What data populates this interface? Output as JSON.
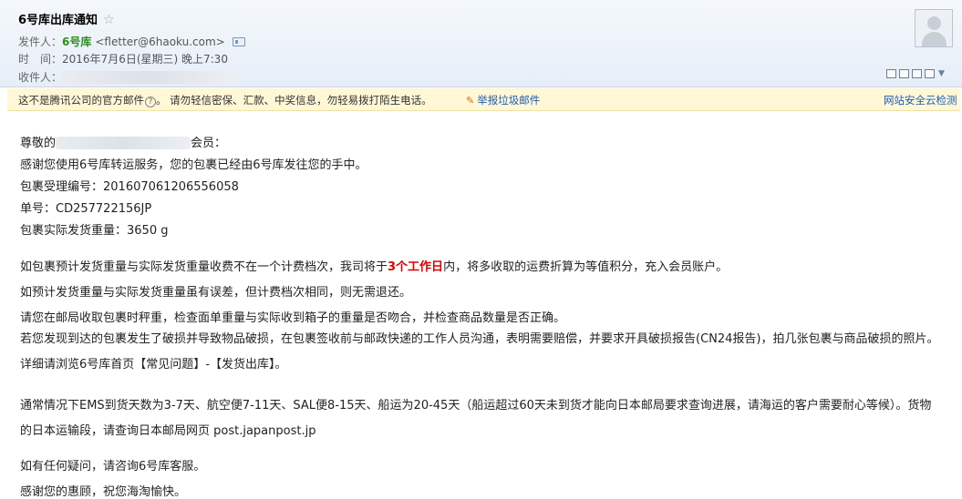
{
  "header": {
    "subject": "6号库出库通知",
    "from_label": "发件人：",
    "sender_name": "6号库",
    "sender_address": "<fletter@6haoku.com>",
    "time_label": "时　间：",
    "time_value": "2016年7月6日(星期三) 晚上7:30",
    "to_label": "收件人："
  },
  "notice": {
    "text": "这不是腾讯公司的官方邮件",
    "question": "?",
    "warning": "。 请勿轻信密保、汇款、中奖信息，勿轻易拨打陌生电话。",
    "report_label": "举报垃圾邮件",
    "security_label": "网站安全云检测"
  },
  "body": {
    "greeting_prefix": "尊敬的",
    "greeting_suffix": "会员：",
    "line_thanks": "感谢您使用6号库转运服务，您的包裹已经由6号库发往您的手中。",
    "line_receipt": "包裹受理编号：201607061206556058",
    "line_tracking": "单号：CD257722156JP",
    "line_weight": "包裹实际发货重量：3650 g",
    "para_refund_before": "如包裹预计发货重量与实际发货重量收费不在一个计费档次，我司将于",
    "para_refund_highlight": "3个工作日",
    "para_refund_after": "内，将多收取的运费折算为等值积分，充入会员账户。",
    "para_no_refund": "如预计发货重量与实际发货重量虽有误差，但计费档次相同，则无需退还。",
    "para_check": "请您在邮局收取包裹时秤重，检查面单重量与实际收到箱子的重量是否吻合，并检查商品数量是否正确。",
    "para_damage": "若您发现到达的包裹发生了破损并导致物品破损，在包裹签收前与邮政快递的工作人员沟通，表明需要赔偿，并要求开具破损报告(CN24报告)，拍几张包裹与商品破损的照片。详细请浏览6号库首页【常见问题】-【发货出库】。",
    "para_shipping": "通常情况下EMS到货天数为3-7天、航空便7-11天、SAL便8-15天、船运为20-45天（船运超过60天未到货才能向日本邮局要求查询进展，请海运的客户需要耐心等候）。货物的日本运输段，请查询日本邮局网页 post.japanpost.jp",
    "para_contact": "如有任何疑问，请咨询6号库客服。",
    "para_closing": "感谢您的惠顾，祝您海淘愉快。"
  }
}
